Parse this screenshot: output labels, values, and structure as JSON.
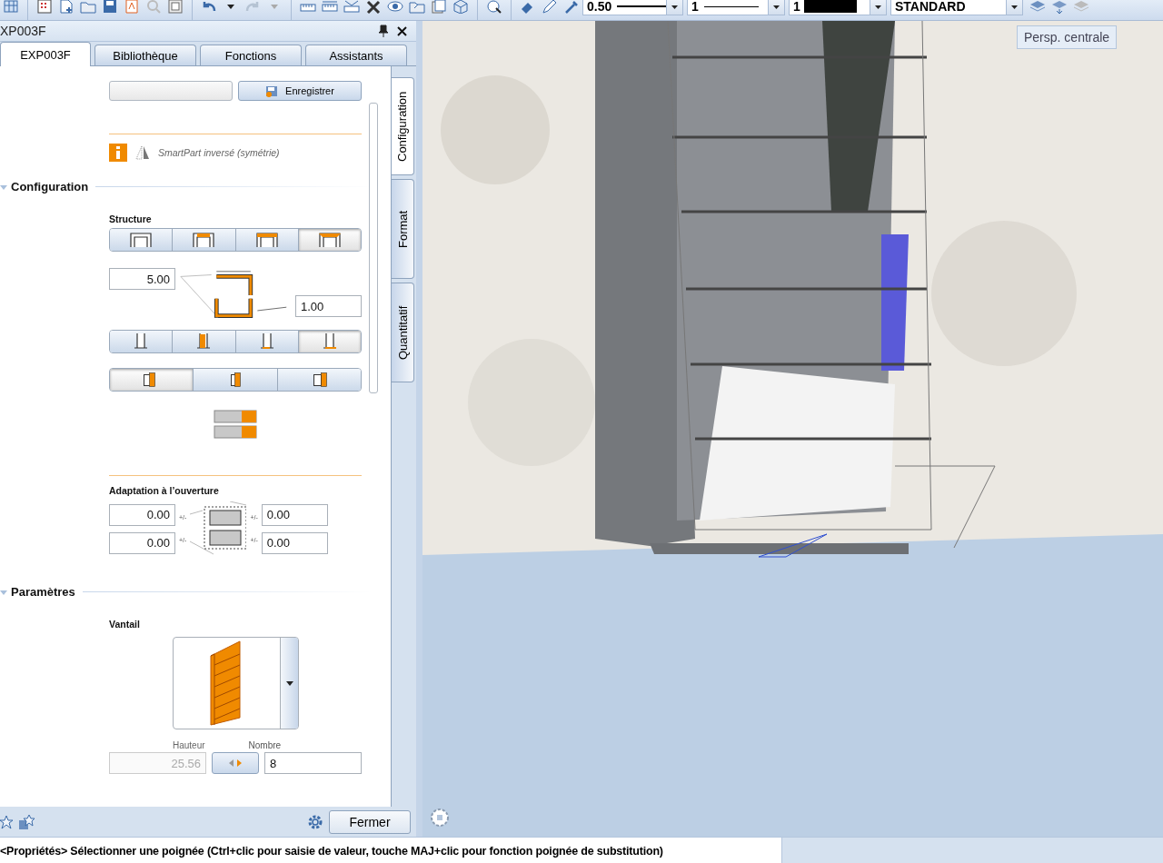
{
  "toolbar": {
    "dropdowns": [
      {
        "kind": "thick",
        "value": "0.50"
      },
      {
        "kind": "thin",
        "value": "1"
      },
      {
        "kind": "swatch",
        "value": "1",
        "color": "#000000"
      },
      {
        "kind": "plain",
        "value": "STANDARD"
      }
    ]
  },
  "panel": {
    "title": "XP003F",
    "tabs": [
      {
        "label": "EXP003F",
        "selected": true
      },
      {
        "label": "Bibliothèque",
        "selected": false
      },
      {
        "label": "Fonctions",
        "selected": false
      },
      {
        "label": "Assistants",
        "selected": false
      }
    ],
    "side_tabs": [
      {
        "label": "Configuration",
        "selected": true
      },
      {
        "label": "Format",
        "selected": false
      },
      {
        "label": "Quantitatif",
        "selected": false
      }
    ],
    "save_button": "Enregistrer",
    "mirror_option": {
      "label": "SmartPart inversé (symétrie)",
      "checked": false
    },
    "configuration": {
      "title": "Configuration",
      "expanded": true,
      "structure_label": "Structure",
      "structure_options": [
        {
          "selected": false
        },
        {
          "selected": false
        },
        {
          "selected": false
        },
        {
          "selected": true
        }
      ],
      "thickness_value": "5.00",
      "depth_value": "1.00",
      "placement_options": [
        {
          "selected": false
        },
        {
          "selected": false
        },
        {
          "selected": false
        },
        {
          "selected": true
        }
      ],
      "side_options": [
        {
          "selected": true
        },
        {
          "selected": false
        },
        {
          "selected": false
        }
      ],
      "opening_label": "Adaptation à l’ouverture",
      "opening_fields": [
        {
          "value": "0.00",
          "hint": "+/-"
        },
        {
          "value": "0.00",
          "hint": "+/-"
        },
        {
          "value": "0.00",
          "hint": "+/-"
        },
        {
          "value": "0.00",
          "hint": "+/-"
        }
      ]
    },
    "parameters": {
      "title": "Paramètres",
      "expanded": true,
      "leaf_label": "Vantail",
      "height_label": "Hauteur",
      "height_value": "25.56",
      "height_disabled": true,
      "count_label": "Nombre",
      "count_value": "8"
    },
    "close_button": "Fermer"
  },
  "viewport": {
    "kind": "picture",
    "tooltip": "Persp. centrale"
  },
  "status_bar": {
    "text": "<Propriétés> Sélectionner une poignée (Ctrl+clic pour saisie de valeur, touche MAJ+clic pour fonction poignée de substitution)"
  }
}
